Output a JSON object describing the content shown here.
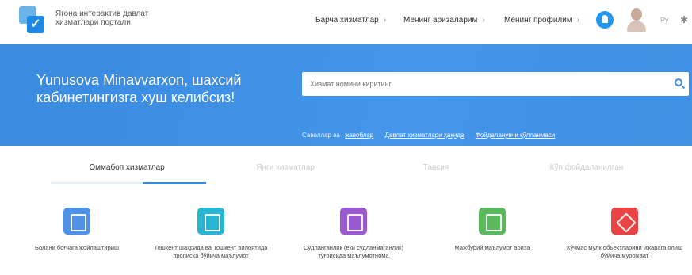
{
  "header": {
    "portal_name": "Ягона интерактив давлат хизматлари портали",
    "nav": [
      {
        "label": "Барча хизматлар"
      },
      {
        "label": "Менинг аризаларим"
      },
      {
        "label": "Менинг профилим"
      }
    ],
    "lang": "Ру"
  },
  "banner": {
    "welcome": "Yunusova Minavvarxon, шахсий кабинетингизга хуш келибсиз!",
    "search_placeholder": "Хизмат номини киритинг",
    "hints_prefix": "Саволлар ва",
    "hint_links": [
      "жавоблар",
      "Давлат хизматлари ҳақида",
      "Фойдаланувчи қўлланмаси"
    ]
  },
  "tabs": [
    {
      "label": "Оммабоп хизматлар",
      "active": true
    },
    {
      "label": "Янги хизматлар",
      "active": false
    },
    {
      "label": "Тавсия",
      "active": false
    },
    {
      "label": "Кўп фойдаланилган",
      "active": false
    }
  ],
  "services": [
    {
      "label": "Болани боғчага жойлаштириш",
      "icon": "kindergarten-icon",
      "color": "#4e91e6"
    },
    {
      "label": "Тошкент шаҳрида ва Тошкент вилоятида прописка бўйича маълумот",
      "icon": "document-person-icon",
      "color": "#27b5d3"
    },
    {
      "label": "Судланганлик (ёки судланмаганлик) тўғрисида маълумотнома",
      "icon": "certificate-icon",
      "color": "#9b59d0"
    },
    {
      "label": "Мажбурий маълумот ариза",
      "icon": "map-icon",
      "color": "#5cb85c"
    },
    {
      "label": "Кўчмас мулк объектларини ижарага олиш бўйича мурожаат",
      "icon": "tools-icon",
      "color": "#e84444"
    }
  ]
}
